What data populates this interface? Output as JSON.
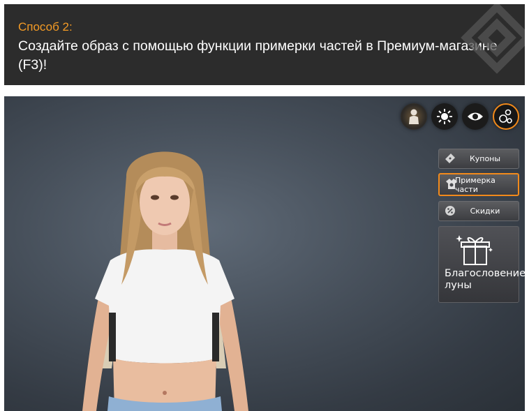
{
  "banner": {
    "method": "Способ 2:",
    "title": "Создайте образ с помощью функции примерки частей в Премиум-магазине (F3)!"
  },
  "top_icons": [
    "character-icon",
    "sun-icon",
    "eye-icon",
    "bubbles-icon"
  ],
  "menu": {
    "coupons": "Купоны",
    "try_on": "Примерка части",
    "discounts": "Скидки",
    "moon_blessing": "Благословение луны"
  },
  "colors": {
    "accent": "#f28a1b",
    "method_text": "#f49b25",
    "banner_bg": "#2c2c2c"
  }
}
